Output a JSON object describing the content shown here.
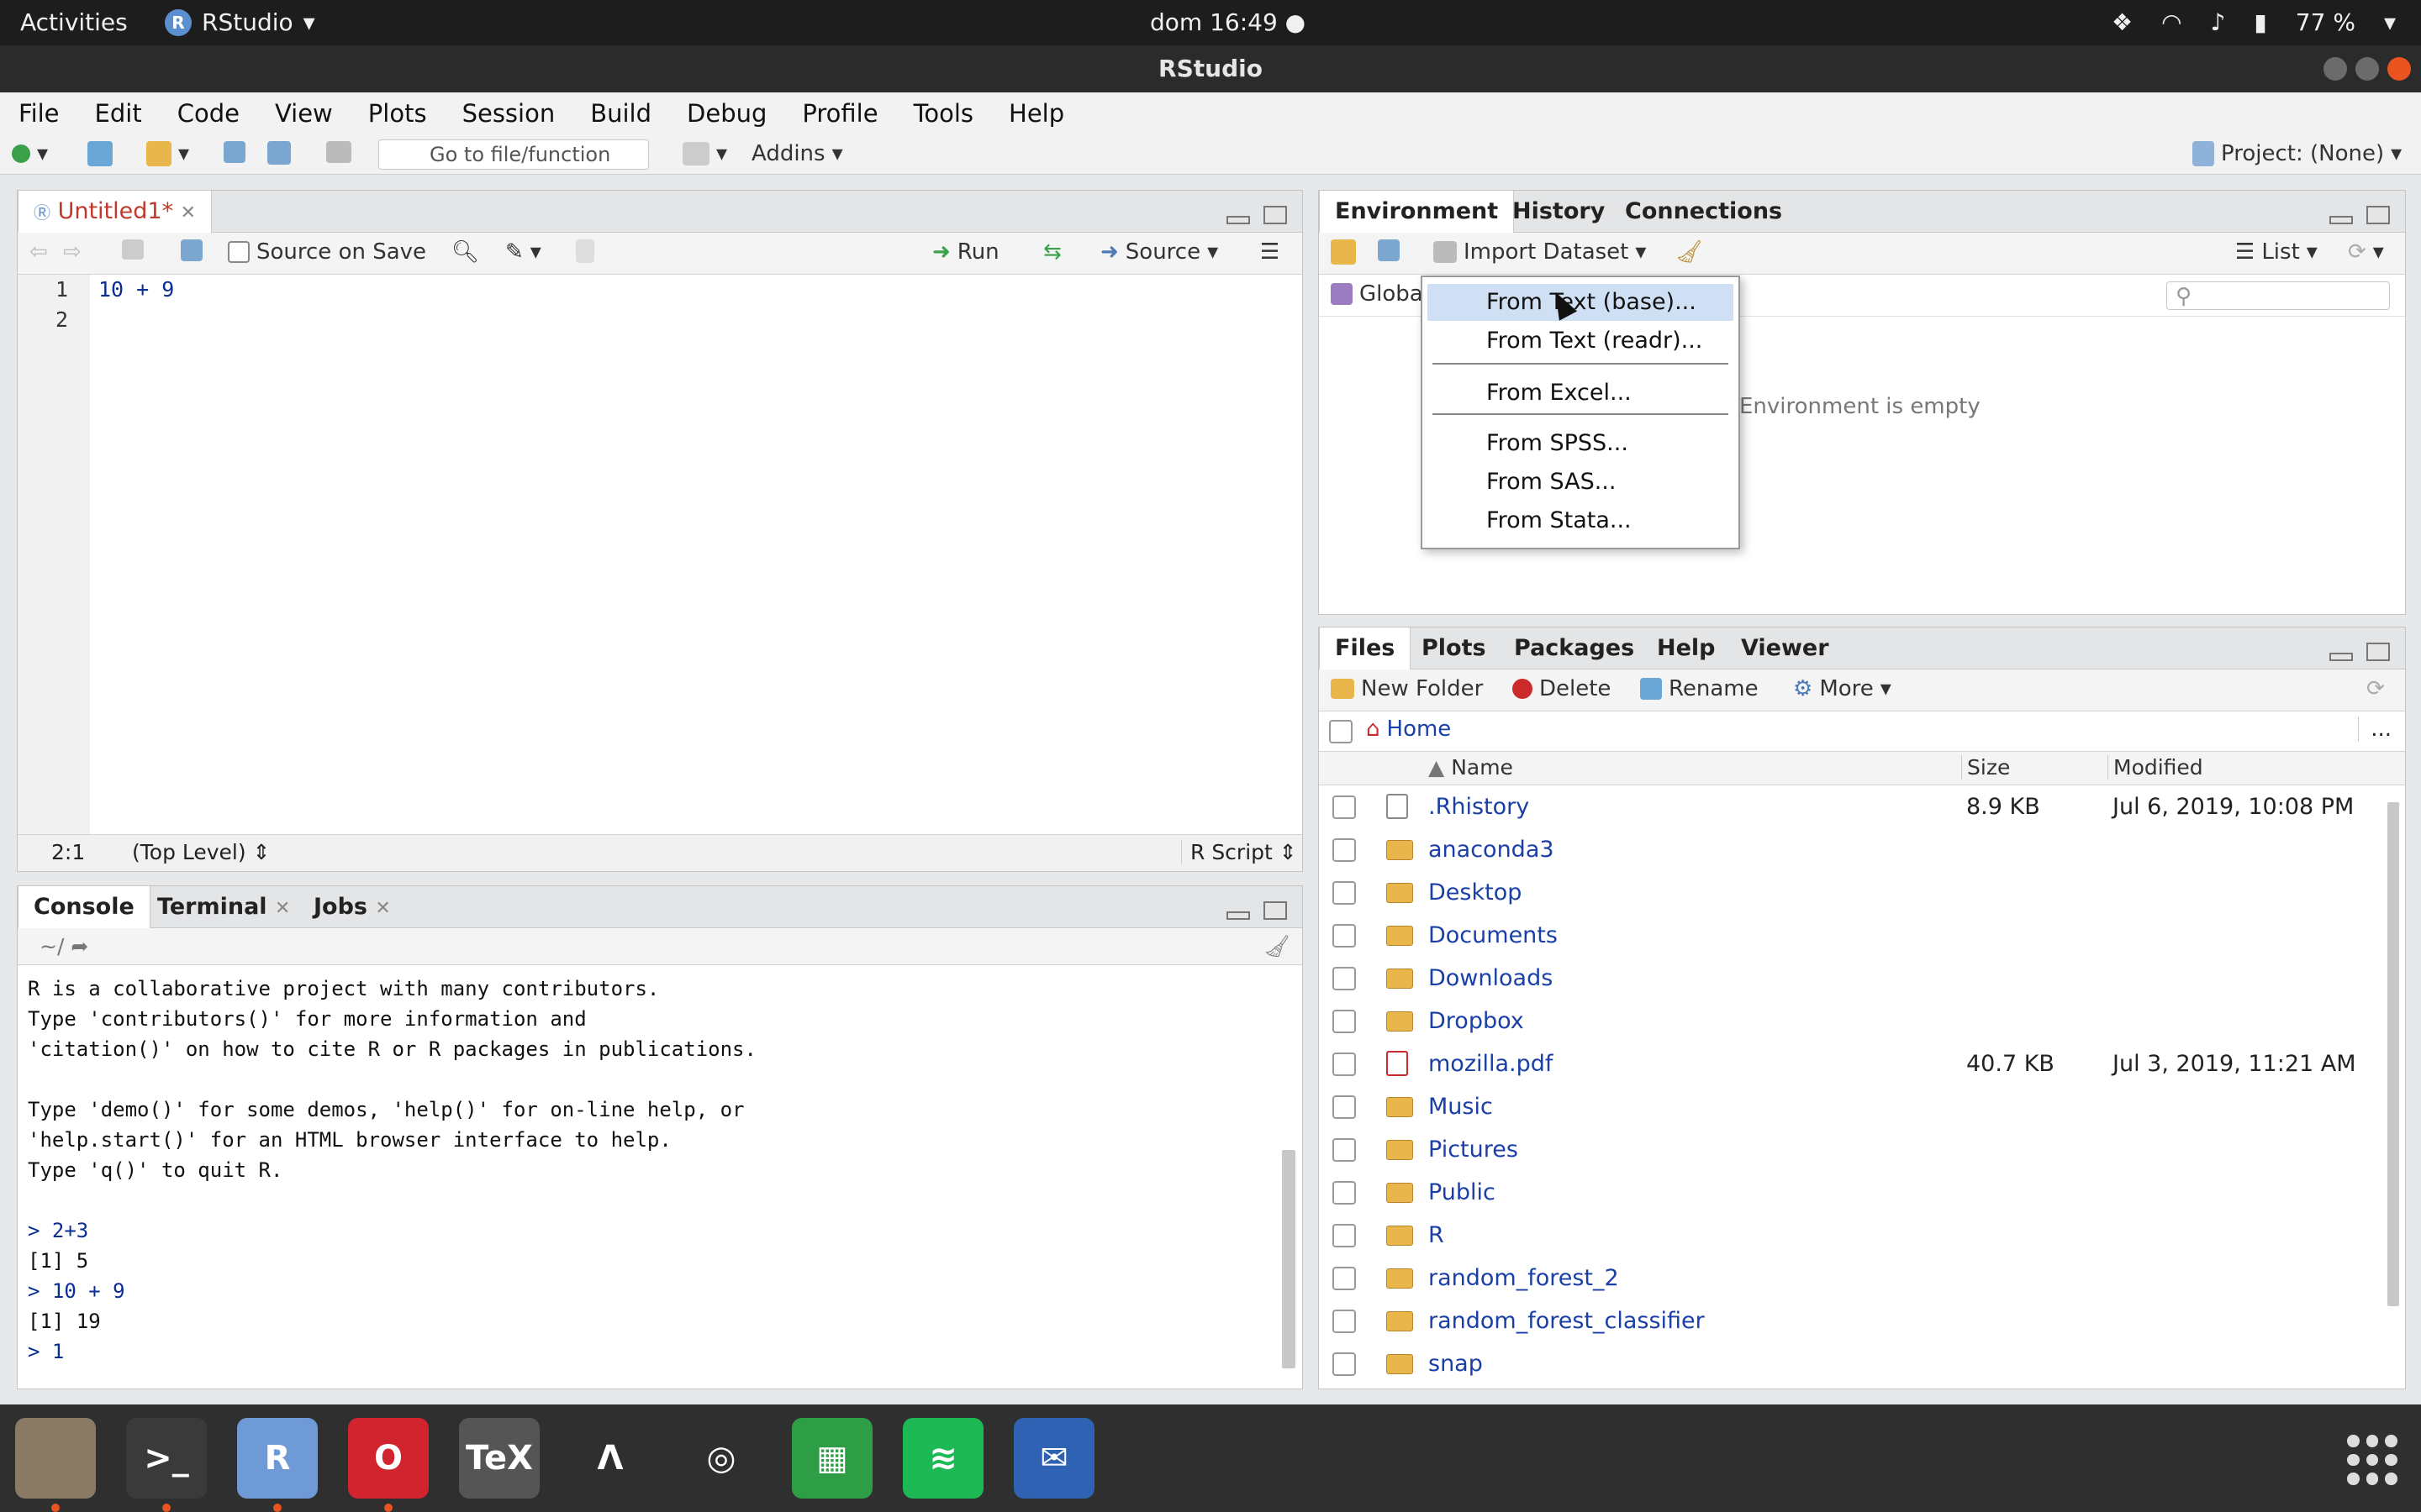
{
  "topbar": {
    "activities": "Activities",
    "app_name": "RStudio",
    "clock": "dom 16:49 ●",
    "battery": "77 %"
  },
  "window": {
    "title": "RStudio"
  },
  "menubar": [
    "File",
    "Edit",
    "Code",
    "View",
    "Plots",
    "Session",
    "Build",
    "Debug",
    "Profile",
    "Tools",
    "Help"
  ],
  "toolbar": {
    "goto_placeholder": "Go to file/function",
    "addins": "Addins",
    "project": "Project: (None)"
  },
  "editor": {
    "tab_label": "Untitled1*",
    "source_on_save": "Source on Save",
    "run": "Run",
    "source": "Source",
    "lines": [
      "1",
      "2"
    ],
    "code": [
      "10 + 9",
      ""
    ],
    "cursor_pos": "2:1",
    "scope": "(Top Level)",
    "file_type": "R Script"
  },
  "console": {
    "tabs": [
      "Console",
      "Terminal",
      "Jobs"
    ],
    "path": "~/",
    "lines": [
      {
        "t": "R is a collaborative project with many contributors.",
        "in": false
      },
      {
        "t": "Type 'contributors()' for more information and",
        "in": false
      },
      {
        "t": "'citation()' on how to cite R or R packages in publications.",
        "in": false
      },
      {
        "t": "",
        "in": false
      },
      {
        "t": "Type 'demo()' for some demos, 'help()' for on-line help, or",
        "in": false
      },
      {
        "t": "'help.start()' for an HTML browser interface to help.",
        "in": false
      },
      {
        "t": "Type 'q()' to quit R.",
        "in": false
      },
      {
        "t": "",
        "in": false
      },
      {
        "t": "> 2+3",
        "in": true
      },
      {
        "t": "[1] 5",
        "in": false
      },
      {
        "t": "> 10 + 9",
        "in": true
      },
      {
        "t": "[1] 19",
        "in": false
      },
      {
        "t": "> 1",
        "in": true
      }
    ]
  },
  "environment": {
    "tabs": [
      "Environment",
      "History",
      "Connections"
    ],
    "import_dataset": "Import Dataset",
    "list_view": "List",
    "scope": "Global",
    "empty_message": "Environment is empty"
  },
  "import_menu": {
    "items": [
      "From Text (base)...",
      "From Text (readr)...",
      "From Excel...",
      "From SPSS...",
      "From SAS...",
      "From Stata..."
    ],
    "highlighted": 0
  },
  "files": {
    "tabs": [
      "Files",
      "Plots",
      "Packages",
      "Help",
      "Viewer"
    ],
    "new_folder": "New Folder",
    "delete": "Delete",
    "rename": "Rename",
    "more": "More",
    "home": "Home",
    "ellipsis": "...",
    "columns": {
      "name": "Name",
      "size": "Size",
      "modified": "Modified"
    },
    "rows": [
      {
        "name": ".Rhistory",
        "kind": "file",
        "size": "8.9 KB",
        "modified": "Jul 6, 2019, 10:08 PM"
      },
      {
        "name": "anaconda3",
        "kind": "folder",
        "size": "",
        "modified": ""
      },
      {
        "name": "Desktop",
        "kind": "folder",
        "size": "",
        "modified": ""
      },
      {
        "name": "Documents",
        "kind": "folder",
        "size": "",
        "modified": ""
      },
      {
        "name": "Downloads",
        "kind": "folder",
        "size": "",
        "modified": ""
      },
      {
        "name": "Dropbox",
        "kind": "folder",
        "size": "",
        "modified": ""
      },
      {
        "name": "mozilla.pdf",
        "kind": "pdf",
        "size": "40.7 KB",
        "modified": "Jul 3, 2019, 11:21 AM"
      },
      {
        "name": "Music",
        "kind": "folder",
        "size": "",
        "modified": ""
      },
      {
        "name": "Pictures",
        "kind": "folder",
        "size": "",
        "modified": ""
      },
      {
        "name": "Public",
        "kind": "folder",
        "size": "",
        "modified": ""
      },
      {
        "name": "R",
        "kind": "folder",
        "size": "",
        "modified": ""
      },
      {
        "name": "random_forest_2",
        "kind": "folder",
        "size": "",
        "modified": ""
      },
      {
        "name": "random_forest_classifier",
        "kind": "folder",
        "size": "",
        "modified": ""
      },
      {
        "name": "snap",
        "kind": "folder",
        "size": "",
        "modified": ""
      }
    ]
  },
  "dock": [
    {
      "name": "files-icon",
      "label": "",
      "color": "#8a7a66",
      "running": true
    },
    {
      "name": "terminal-icon",
      "label": ">_",
      "color": "#3a3a3a",
      "running": true
    },
    {
      "name": "rstudio-icon",
      "label": "R",
      "color": "#6f9ad8",
      "running": true
    },
    {
      "name": "opera-icon",
      "label": "O",
      "color": "#d1242f",
      "running": true
    },
    {
      "name": "texmaker-icon",
      "label": "TeX",
      "color": "#555555",
      "running": false
    },
    {
      "name": "arduino-like-icon",
      "label": "Λ",
      "color": "#2f2f2f",
      "running": false
    },
    {
      "name": "ubuntu-software-icon",
      "label": "◎",
      "color": "#2f2f2f",
      "running": false
    },
    {
      "name": "libreoffice-calc-icon",
      "label": "▦",
      "color": "#2e9e46",
      "running": false
    },
    {
      "name": "spotify-icon",
      "label": "≋",
      "color": "#1db954",
      "running": false
    },
    {
      "name": "thunderbird-icon",
      "label": "✉",
      "color": "#2f62b3",
      "running": false
    }
  ]
}
